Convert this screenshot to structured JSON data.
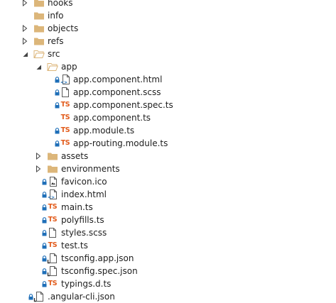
{
  "colors": {
    "folder": "#dcb67a",
    "lock": "#1f6fb8",
    "ts": "#e25b1b",
    "arrow": "#444444",
    "file_outline": "#5a5a5a"
  },
  "tree": [
    {
      "label": "hooks",
      "depth": 0,
      "arrow": "right",
      "icon": "folder-icon",
      "lock": false
    },
    {
      "label": "info",
      "depth": 0,
      "arrow": "none",
      "icon": "folder-icon",
      "lock": false
    },
    {
      "label": "objects",
      "depth": 0,
      "arrow": "right",
      "icon": "folder-icon",
      "lock": false
    },
    {
      "label": "refs",
      "depth": 0,
      "arrow": "right",
      "icon": "folder-icon",
      "lock": false
    },
    {
      "label": "src",
      "depth": 0,
      "arrow": "down",
      "icon": "folder-open-icon",
      "lock": false
    },
    {
      "label": "app",
      "depth": 1,
      "arrow": "down",
      "icon": "folder-open-icon",
      "lock": false
    },
    {
      "label": "app.component.html",
      "depth": 2,
      "arrow": "none",
      "icon": "html-file-icon",
      "lock": true
    },
    {
      "label": "app.component.scss",
      "depth": 2,
      "arrow": "none",
      "icon": "file-icon",
      "lock": true
    },
    {
      "label": "app.component.spec.ts",
      "depth": 2,
      "arrow": "none",
      "icon": "ts-icon",
      "lock": true,
      "ts_text": "TS"
    },
    {
      "label": "app.component.ts",
      "depth": 2,
      "arrow": "none",
      "icon": "ts-icon",
      "lock": false,
      "ts_text": "TS"
    },
    {
      "label": "app.module.ts",
      "depth": 2,
      "arrow": "none",
      "icon": "ts-icon",
      "lock": true,
      "ts_text": "TS"
    },
    {
      "label": "app-routing.module.ts",
      "depth": 2,
      "arrow": "none",
      "icon": "ts-icon",
      "lock": true,
      "ts_text": "TS"
    },
    {
      "label": "assets",
      "depth": 1,
      "arrow": "right",
      "icon": "folder-icon",
      "lock": false
    },
    {
      "label": "environments",
      "depth": 1,
      "arrow": "right",
      "icon": "folder-icon",
      "lock": false
    },
    {
      "label": "favicon.ico",
      "depth": 1,
      "arrow": "none",
      "icon": "image-file-icon",
      "lock": true
    },
    {
      "label": "index.html",
      "depth": 1,
      "arrow": "none",
      "icon": "html-file-icon",
      "lock": true
    },
    {
      "label": "main.ts",
      "depth": 1,
      "arrow": "none",
      "icon": "ts-icon",
      "lock": true,
      "ts_text": "TS"
    },
    {
      "label": "polyfills.ts",
      "depth": 1,
      "arrow": "none",
      "icon": "ts-icon",
      "lock": true,
      "ts_text": "TS"
    },
    {
      "label": "styles.scss",
      "depth": 1,
      "arrow": "none",
      "icon": "file-icon",
      "lock": true
    },
    {
      "label": "test.ts",
      "depth": 1,
      "arrow": "none",
      "icon": "ts-icon",
      "lock": true,
      "ts_text": "TS"
    },
    {
      "label": "tsconfig.app.json",
      "depth": 1,
      "arrow": "none",
      "icon": "json-file-icon",
      "lock": true
    },
    {
      "label": "tsconfig.spec.json",
      "depth": 1,
      "arrow": "none",
      "icon": "json-file-icon",
      "lock": true
    },
    {
      "label": "typings.d.ts",
      "depth": 1,
      "arrow": "none",
      "icon": "ts-icon",
      "lock": true,
      "ts_text": "TS"
    },
    {
      "label": ".angular-cli.json",
      "depth": 0,
      "arrow": "none",
      "icon": "json-file-icon",
      "lock": true
    }
  ]
}
